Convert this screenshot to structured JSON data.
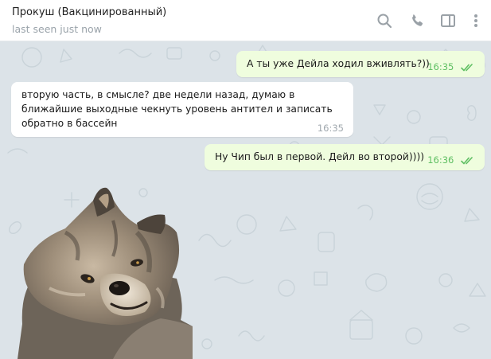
{
  "header": {
    "title": "Прокуш (Вакцинированный)",
    "status": "last seen just now",
    "icons": [
      "search-icon",
      "phone-icon",
      "sidebar-toggle-icon",
      "more-vertical-icon"
    ]
  },
  "colors": {
    "outgoing_bubble": "#effdde",
    "incoming_bubble": "#ffffff",
    "read_ticks": "#5fbf63",
    "chat_background": "#dce3e8",
    "header_background": "#ffffff"
  },
  "messages": [
    {
      "direction": "out",
      "text": "А ты уже Дейла ходил вживлять?))",
      "time": "16:35",
      "read": true
    },
    {
      "direction": "in",
      "lines": [
        "вторую часть, в смысле? две недели назад, думаю в",
        "ближайшие выходные чекнуть уровень антител и записать",
        "обратно в бассейн"
      ],
      "time": "16:35"
    },
    {
      "direction": "out",
      "text": "Ну Чип был в первой. Дейл во второй))))",
      "time": "16:36",
      "read": true
    },
    {
      "direction": "in",
      "type": "sticker",
      "sticker": "wolf-sticker"
    }
  ]
}
